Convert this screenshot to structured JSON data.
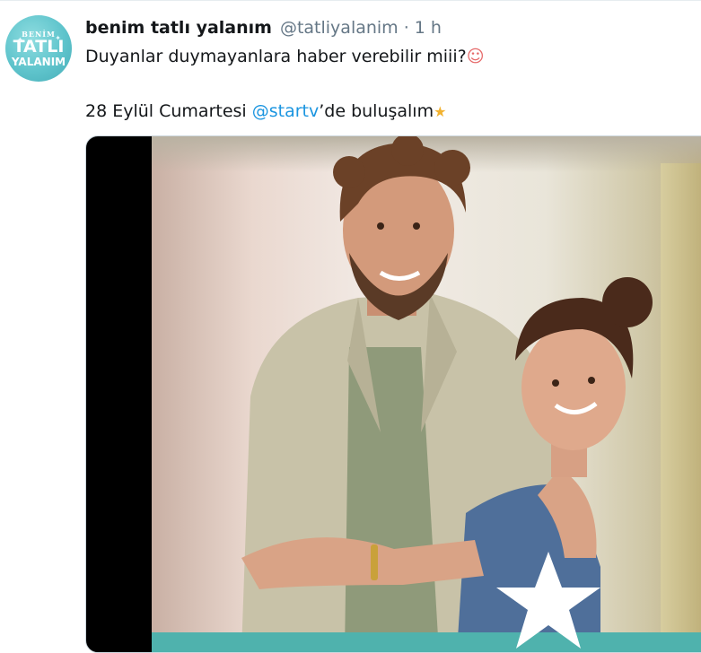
{
  "tweet": {
    "display_name": "benim tatlı yalanım",
    "handle": "@tatliyalanim",
    "separator": "·",
    "time": "1 h",
    "line1": {
      "text": "Duyanlar duymayanlara haber verebilir miii?",
      "emoji": "☺"
    },
    "line2": {
      "prefix": "28 Eylül Cumartesi ",
      "mention": "@startv",
      "suffix": "’de buluşalım",
      "emoji": "★"
    }
  },
  "avatar": {
    "top_text": "BENİM",
    "mid_text": "TATLI",
    "bottom_text": "YALANIM",
    "background_color": "#5fc4cc"
  },
  "colors": {
    "link": "#1b95e0",
    "secondary_text": "#657786",
    "primary_text": "#14171a",
    "media_border": "#ccd6dd"
  },
  "icons": {
    "line1_emoji": "smiling-face-with-rosy-cheeks-emoji",
    "line2_emoji": "dizzy-star-emoji",
    "media_overlay": "white-star-icon"
  }
}
